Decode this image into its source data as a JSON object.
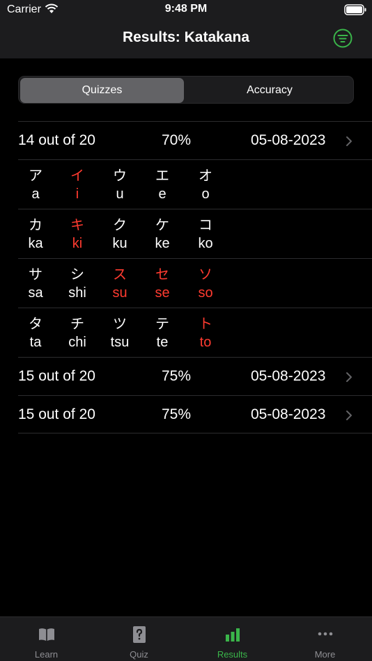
{
  "status": {
    "carrier": "Carrier",
    "time": "9:48 PM"
  },
  "nav": {
    "title": "Results: Katakana",
    "filter_icon": "filter-icon"
  },
  "segments": {
    "quizzes": "Quizzes",
    "accuracy": "Accuracy",
    "selected": "Quizzes"
  },
  "results": [
    {
      "score": "14 out of 20",
      "percent": "70%",
      "date": "05-08-2023"
    },
    {
      "score": "15 out of 20",
      "percent": "75%",
      "date": "05-08-2023"
    },
    {
      "score": "15 out of 20",
      "percent": "75%",
      "date": "05-08-2023"
    }
  ],
  "kana_rows": [
    [
      {
        "kana": "ア",
        "romaji": "a",
        "wrong": false
      },
      {
        "kana": "イ",
        "romaji": "i",
        "wrong": true
      },
      {
        "kana": "ウ",
        "romaji": "u",
        "wrong": false
      },
      {
        "kana": "エ",
        "romaji": "e",
        "wrong": false
      },
      {
        "kana": "オ",
        "romaji": "o",
        "wrong": false
      }
    ],
    [
      {
        "kana": "カ",
        "romaji": "ka",
        "wrong": false
      },
      {
        "kana": "キ",
        "romaji": "ki",
        "wrong": true
      },
      {
        "kana": "ク",
        "romaji": "ku",
        "wrong": false
      },
      {
        "kana": "ケ",
        "romaji": "ke",
        "wrong": false
      },
      {
        "kana": "コ",
        "romaji": "ko",
        "wrong": false
      }
    ],
    [
      {
        "kana": "サ",
        "romaji": "sa",
        "wrong": false
      },
      {
        "kana": "シ",
        "romaji": "shi",
        "wrong": false
      },
      {
        "kana": "ス",
        "romaji": "su",
        "wrong": true
      },
      {
        "kana": "セ",
        "romaji": "se",
        "wrong": true
      },
      {
        "kana": "ソ",
        "romaji": "so",
        "wrong": true
      }
    ],
    [
      {
        "kana": "タ",
        "romaji": "ta",
        "wrong": false
      },
      {
        "kana": "チ",
        "romaji": "chi",
        "wrong": false
      },
      {
        "kana": "ツ",
        "romaji": "tsu",
        "wrong": false
      },
      {
        "kana": "テ",
        "romaji": "te",
        "wrong": false
      },
      {
        "kana": "ト",
        "romaji": "to",
        "wrong": true
      }
    ]
  ],
  "tabs": [
    {
      "label": "Learn",
      "icon": "book-icon",
      "active": false
    },
    {
      "label": "Quiz",
      "icon": "question-card-icon",
      "active": false
    },
    {
      "label": "Results",
      "icon": "bar-chart-icon",
      "active": true
    },
    {
      "label": "More",
      "icon": "ellipsis-icon",
      "active": false
    }
  ],
  "colors": {
    "accent": "#3ab54a",
    "wrong": "#ff3b30",
    "background": "#000000",
    "bar": "#1c1c1e"
  }
}
